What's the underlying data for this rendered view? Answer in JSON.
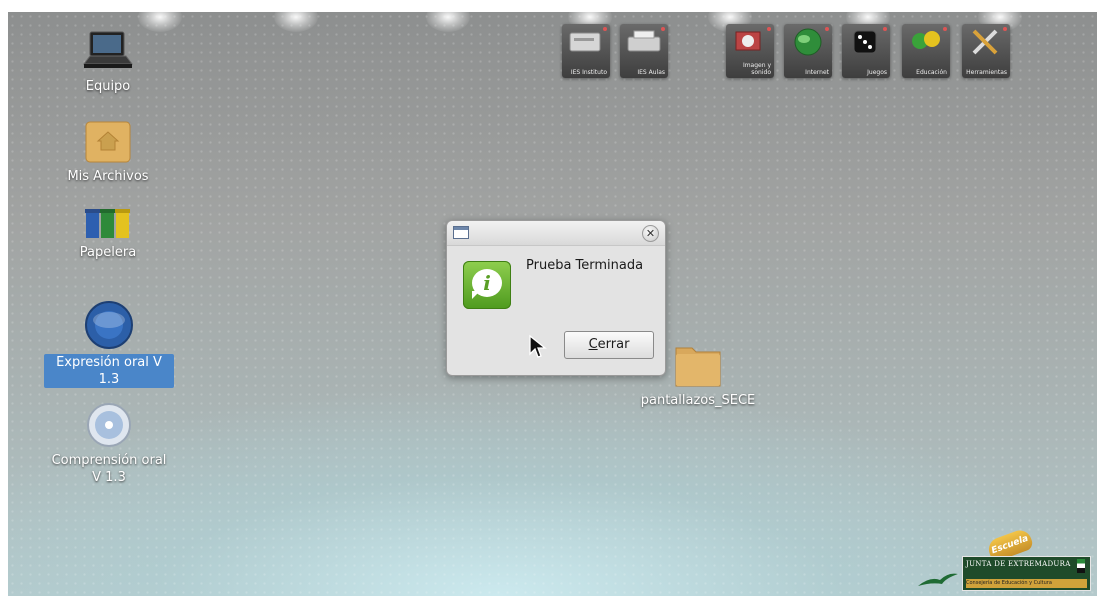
{
  "desktop_icons": [
    {
      "label": "Equipo",
      "icon": "laptop-icon"
    },
    {
      "label": "Mis Archivos",
      "icon": "home-folder-icon"
    },
    {
      "label": "Papelera",
      "icon": "recycle-bins-icon"
    },
    {
      "label": "Expresión oral V 1.3",
      "icon": "globe-app-icon",
      "selected": true
    },
    {
      "label": "Comprensión oral V 1.3",
      "icon": "disc-app-icon"
    },
    {
      "label": "pantallazos_SECE",
      "icon": "folder-icon"
    }
  ],
  "launchers": [
    {
      "label": "IES Instituto",
      "icon": "server-icon"
    },
    {
      "label": "IES Aulas",
      "icon": "printer-icon"
    },
    {
      "label": "Imagen y sonido",
      "icon": "media-icon"
    },
    {
      "label": "Internet",
      "icon": "globe-icon"
    },
    {
      "label": "Juegos",
      "icon": "dice-icon"
    },
    {
      "label": "Educación",
      "icon": "linex-edu-icon"
    },
    {
      "label": "Herramientas",
      "icon": "tools-icon"
    }
  ],
  "dialog": {
    "message": "Prueba Terminada",
    "button_rest": "errar",
    "button_mnemonic": "C",
    "icon": "info-icon"
  },
  "branding": {
    "escuela": "Escuela",
    "junta": "JUNTA DE EXTREMADURA",
    "consejeria": "Consejería de Educación y Cultura"
  },
  "colors": {
    "selection": "#4a86c9",
    "dialog_bg": "#e3e3e3",
    "info_green": "#5a9f25"
  }
}
